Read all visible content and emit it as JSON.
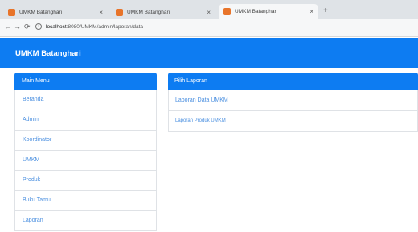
{
  "browser": {
    "tabs": [
      {
        "title": "UMKM Batanghari",
        "close": "×"
      },
      {
        "title": "UMKM Batanghari",
        "close": "×"
      },
      {
        "title": "UMKM Batanghari",
        "close": "×"
      }
    ],
    "new_tab": "+",
    "nav": {
      "back": "←",
      "forward": "→",
      "reload": "⟳"
    },
    "url": {
      "info": "i",
      "host": "localhost",
      "path": ":8080/UMKM/admin/laporan/data"
    }
  },
  "header": {
    "brand": "UMKM Batanghari"
  },
  "sidebar": {
    "title": "Main Menu",
    "items": [
      {
        "label": "Beranda"
      },
      {
        "label": "Admin"
      },
      {
        "label": "Koordinator"
      },
      {
        "label": "UMKM"
      },
      {
        "label": "Produk"
      },
      {
        "label": "Buku Tamu"
      },
      {
        "label": "Laporan"
      }
    ]
  },
  "panel": {
    "title": "Pilih Laporan",
    "items": [
      {
        "label": "Laporan Data UMKM"
      },
      {
        "label": "Laporan Produk UMKM"
      }
    ]
  },
  "colors": {
    "accent": "#0d7cf2",
    "link": "#4a8fe0",
    "favicon": "#e8742a"
  }
}
